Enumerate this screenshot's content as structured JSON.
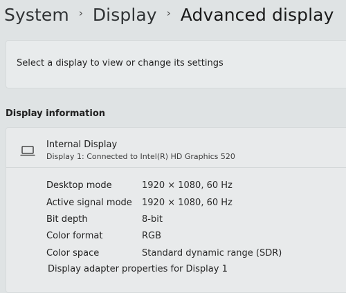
{
  "breadcrumb": {
    "items": [
      "System",
      "Display",
      "Advanced display"
    ],
    "separator": "›"
  },
  "select_display": {
    "text": "Select a display to view or change its settings"
  },
  "display_information": {
    "heading": "Display information",
    "display_name": "Internal Display",
    "display_subtitle": "Display 1: Connected to Intel(R) HD Graphics 520",
    "icon": "monitor-icon",
    "properties": [
      {
        "label": "Desktop mode",
        "value": "1920 × 1080, 60 Hz"
      },
      {
        "label": "Active signal mode",
        "value": "1920 × 1080, 60 Hz"
      },
      {
        "label": "Bit depth",
        "value": "8-bit"
      },
      {
        "label": "Color format",
        "value": "RGB"
      },
      {
        "label": "Color space",
        "value": "Standard dynamic range (SDR)"
      }
    ],
    "adapter_link": "Display adapter properties for Display 1"
  },
  "colors": {
    "background": "#dfe3e4",
    "card": "#e8ebec",
    "text": "#1b1b1b"
  }
}
